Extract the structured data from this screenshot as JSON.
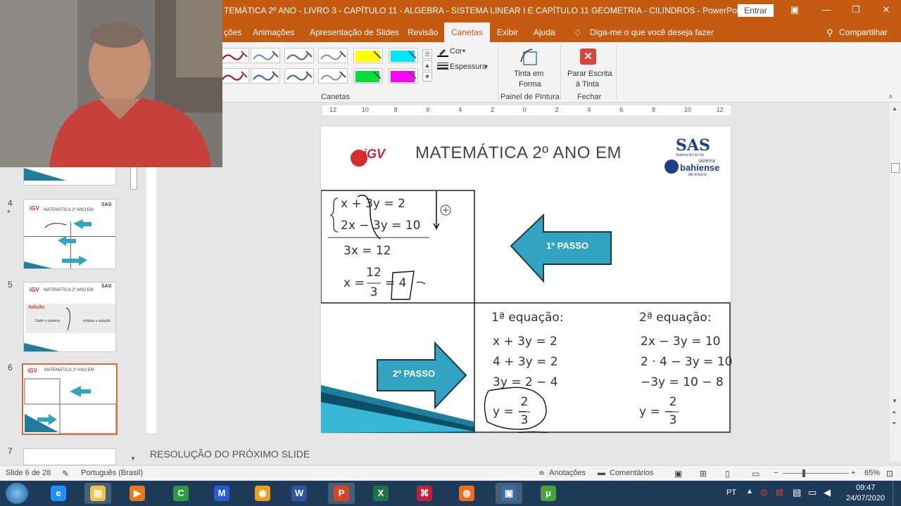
{
  "window": {
    "title": "TEMÁTICA 2º ANO - LIVRO 3 - CAPÍTULO 11 - ALGEBRA - SISTEMA LINEAR I E CAPÍTULO 11  GEOMETRIA - CILINDROS  -  PowerPoint",
    "signin_label": "Entrar"
  },
  "ribbon_tabs": [
    {
      "label": "ções"
    },
    {
      "label": "Animações"
    },
    {
      "label": "Apresentação de Slides"
    },
    {
      "label": "Revisão"
    },
    {
      "label": "Canetas",
      "active": true
    },
    {
      "label": "Exibir"
    },
    {
      "label": "Ajuda"
    }
  ],
  "tell_me": "Diga-me o que você deseja fazer",
  "share_label": "Compartilhar",
  "ribbon": {
    "pens_group": "Canetas",
    "color_label": "Cor",
    "thickness_label": "Espessura",
    "ink_to_shape": [
      "Tinta em",
      "Forma"
    ],
    "drawing_pane_group": "Painel de Pintura",
    "stop_inking": [
      "Parar Escrita",
      "à Tinta"
    ],
    "close_group": "Fechar",
    "pen_colors": [
      "#c00000",
      "#5b8fc7",
      "#3a7a4a",
      "#8e8e8e",
      "#ffff00",
      "#00e5ff",
      "#c00000",
      "#2e5fa8",
      "#2e7a42",
      "#8e8e8e",
      "#00dd33",
      "#ff00ff"
    ]
  },
  "ruler_labels": [
    "12",
    "10",
    "8",
    "6",
    "4",
    "2",
    "0",
    "2",
    "4",
    "6",
    "8",
    "10",
    "12"
  ],
  "thumbnails": [
    {
      "num": "4",
      "star": "*",
      "title": "MATEMÁTICA 2º ANO EM"
    },
    {
      "num": "5",
      "title": "MATEMÁTICA 2º ANO EM",
      "heading": "Adição",
      "text": "Dado o sistema",
      "text2": "indique a solução."
    },
    {
      "num": "6",
      "title": "MATEMÁTICA 2º ANO EM"
    },
    {
      "num": "7"
    }
  ],
  "slide": {
    "title": "MATEMÁTICA 2º ANO EM",
    "logo_left": "iGV",
    "logo_sas": "SAS",
    "logo_sas_sub": "Sistema Ari de Sá",
    "logo_sistema": "sistema",
    "logo_bahiense": "bahiense",
    "logo_ensino": "de ensino",
    "eq1": "x + 3y = 2",
    "eq2": "2x − 3y = 10",
    "sum": "3x = 12",
    "x_prefix": "x =",
    "x_num": "12",
    "x_den": "3",
    "x_result": "= 4",
    "step1": "1º PASSO",
    "step2": "2º PASSO",
    "first_eq_title": "1ª equação:",
    "first_eq_lines": [
      "x + 3y = 2",
      "4 + 3y = 2",
      "3y = 2 − 4"
    ],
    "first_eq_result_prefix": "y = −",
    "first_eq_num": "2",
    "first_eq_den": "3",
    "second_eq_title": "2ª equação:",
    "second_eq_lines": [
      "2x − 3y = 10",
      "2 · 4 − 3y = 10",
      "−3y = 10 − 8"
    ],
    "second_eq_result_prefix": "y = −",
    "second_eq_num": "2",
    "second_eq_den": "3"
  },
  "notes": "RESOLUÇÃO DO PRÓXIMO SLIDE",
  "status": {
    "slide_info": "Slide 6 de 28",
    "language": "Português (Brasil)",
    "notes_label": "Anotações",
    "comments_label": "Comentários",
    "zoom_level": "65%"
  },
  "tray": {
    "lang": "PT",
    "time": "09:47",
    "date": "24/07/2020"
  },
  "taskbar_apps": [
    "start",
    "internet-explorer",
    "file-explorer",
    "media-player",
    "camtasia",
    "malwarebytes",
    "chrome",
    "word",
    "powerpoint",
    "excel",
    "mindmeister",
    "firefox",
    "camtasia-recorder",
    "utorrent"
  ]
}
